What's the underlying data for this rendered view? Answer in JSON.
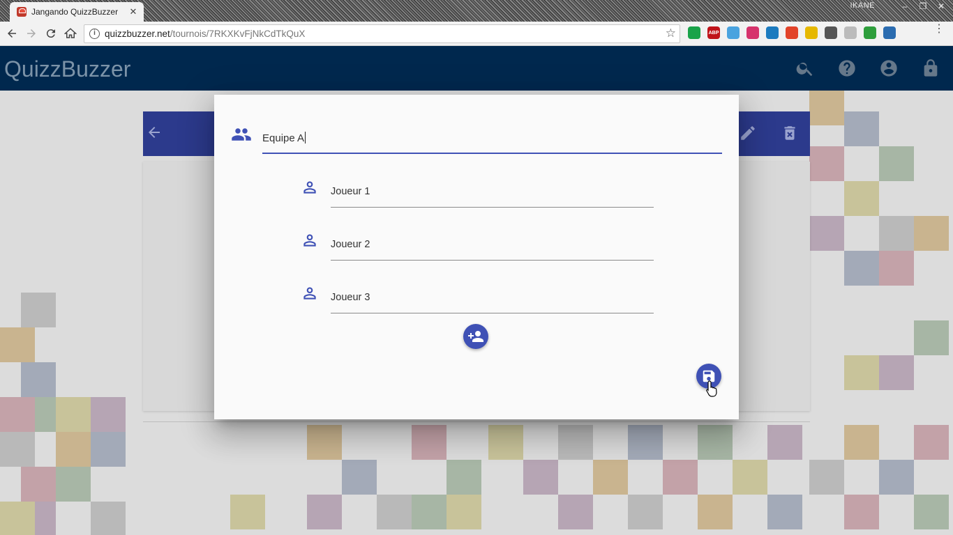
{
  "browser": {
    "tab_title": "Jangando QuizzBuzzer",
    "tab_close": "✕",
    "window_user": "IKANE",
    "url_host": "quizzbuzzer.net",
    "url_path": "/tournois/7RKXKvFjNkCdTkQuX",
    "extensions": [
      {
        "name": "evernote-extension-icon",
        "color": "#1aa34a",
        "label": ""
      },
      {
        "name": "adblock-plus-extension-icon",
        "color": "#c0131a",
        "label": "ABP"
      },
      {
        "name": "cloud-extension-icon",
        "color": "#4aa3df",
        "label": ""
      },
      {
        "name": "record-extension-icon",
        "color": "#d6336c",
        "label": ""
      },
      {
        "name": "eye-extension-icon",
        "color": "#1c7bbf",
        "label": ""
      },
      {
        "name": "gitlab-extension-icon",
        "color": "#e24329",
        "label": ""
      },
      {
        "name": "notes-extension-icon",
        "color": "#e6b800",
        "label": ""
      },
      {
        "name": "eyedropper-extension-icon",
        "color": "#555555",
        "label": ""
      },
      {
        "name": "chat-extension-icon",
        "color": "#bbbbbb",
        "label": ""
      },
      {
        "name": "check-extension-icon",
        "color": "#2e9e3c",
        "label": ""
      },
      {
        "name": "stackedit-extension-icon",
        "color": "#2b6cb0",
        "label": ""
      }
    ]
  },
  "app": {
    "brand": "QuizzBuzzer",
    "appbar_icons": [
      "search-icon",
      "help-icon",
      "account-icon",
      "lock-icon"
    ]
  },
  "dialog": {
    "team_name": "Equipe A",
    "players": [
      {
        "name": "Joueur 1"
      },
      {
        "name": "Joueur 2"
      },
      {
        "name": "Joueur 3"
      }
    ],
    "add_player_icon": "add-person-icon",
    "save_icon": "save-icon"
  },
  "colors": {
    "appbar": "#00284e",
    "primary": "#3f51b5",
    "card_header": "#2c3a8c"
  }
}
